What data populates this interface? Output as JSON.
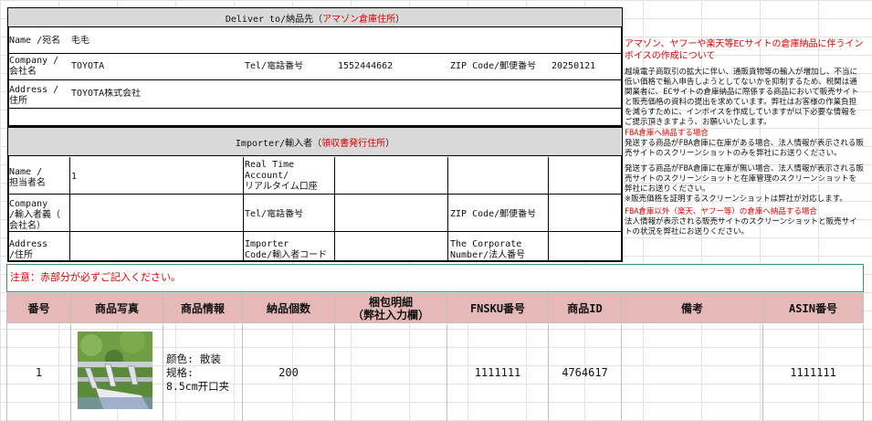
{
  "deliver": {
    "header_prefix": "Deliver to/納品先（",
    "header_red": "アマゾン倉庫住所",
    "header_suffix": "）",
    "name_label": "Name /宛名",
    "name_value": "毛毛",
    "company_label": "Company /\n会社名",
    "company_value": "TOYOTA",
    "tel_label": "Tel/電話番号",
    "tel_value": "1552444662",
    "zip_label": "ZIP Code/郵便番号",
    "zip_value": "20250121",
    "address_label": "Address /\n住所",
    "address_value": "TOYOTA株式会社"
  },
  "importer": {
    "header_prefix": "Importer/輸入者（",
    "header_red": "領収書発行住所",
    "header_suffix": "）",
    "name_label": "Name /\n担当者名",
    "name_value": "1",
    "realtime_label": "Real Time\nAccount/\nリアルタイム口座",
    "company_label": "Company\n/輸入者義（\n会社名）",
    "tel_label": "Tel/電話番号",
    "zip_label": "ZIP Code/郵便番号",
    "address_label": "Address\n/住所",
    "importer_code_label": "Importer\nCode/輸入者コード",
    "corporate_label": "The Corporate\nNumber/法人番号"
  },
  "side_notes": {
    "title": "アマゾン、ヤフーや楽天等ECサイトの倉庫納品に伴うインボイスの作成について",
    "para1": "越境電子商取引の拡大に伴い、通販貨物等の輸入が増加し、不当に低い価格で輸入申告しようとしてないかを抑制するため、税関は通関業者に、ECサイトの倉庫納品に際係する商品において販売サイトと販売価格の資料の提出を求めています。弊社はお客様の作業負担を減らすために、インボイスを作成していますが以下必要な情報をご提示頂きますよう、お願いいたします。",
    "fba_title": "FBA倉庫へ納品する場合",
    "fba_para1": "発送する商品がFBA倉庫に在庫がある場合、法人情報が表示される販売サイトのスクリーンショットのみを弊社にお送りください。",
    "fba_para2": "発送する商品がFBA倉庫に在庫が無い場合、法人情報が表示される販売サイトのスクリーンショットと在庫管理のスクリーンショットを弊社にお送りください。\n※販売価格を証明するスクリーンショットは弊社が対応します。",
    "other_title": "FBA倉庫以外（楽天、ヤフー等）の倉庫へ納品する場合",
    "other_para": "法人情報が表示される販売サイトのスクリーンショットと販売サイトの状況を弊社にお送りください。"
  },
  "notice": "注意：赤部分が必ずご記入ください。",
  "table": {
    "headers": [
      "番号",
      "商品写真",
      "商品情報",
      "納品個数",
      "梱包明細\n（弊社入力欄）",
      "FNSKU番号",
      "商品ID",
      "備考",
      "ASIN番号"
    ],
    "row": {
      "no": "1",
      "info": "颜色: 散装\n规格:\n8.5cm开口夹",
      "qty": "200",
      "packing": "",
      "fnsku": "1111111",
      "product_id": "4764617",
      "remarks": "",
      "asin": "1111111"
    }
  },
  "colors": {
    "header_gray": "#d9d9d9",
    "table_header_pink": "#e6b8b8",
    "accent_red": "#e00000",
    "notice_border": "#3a9a4a"
  },
  "icons": {
    "product_photo": "clothespin-clip-photo"
  }
}
